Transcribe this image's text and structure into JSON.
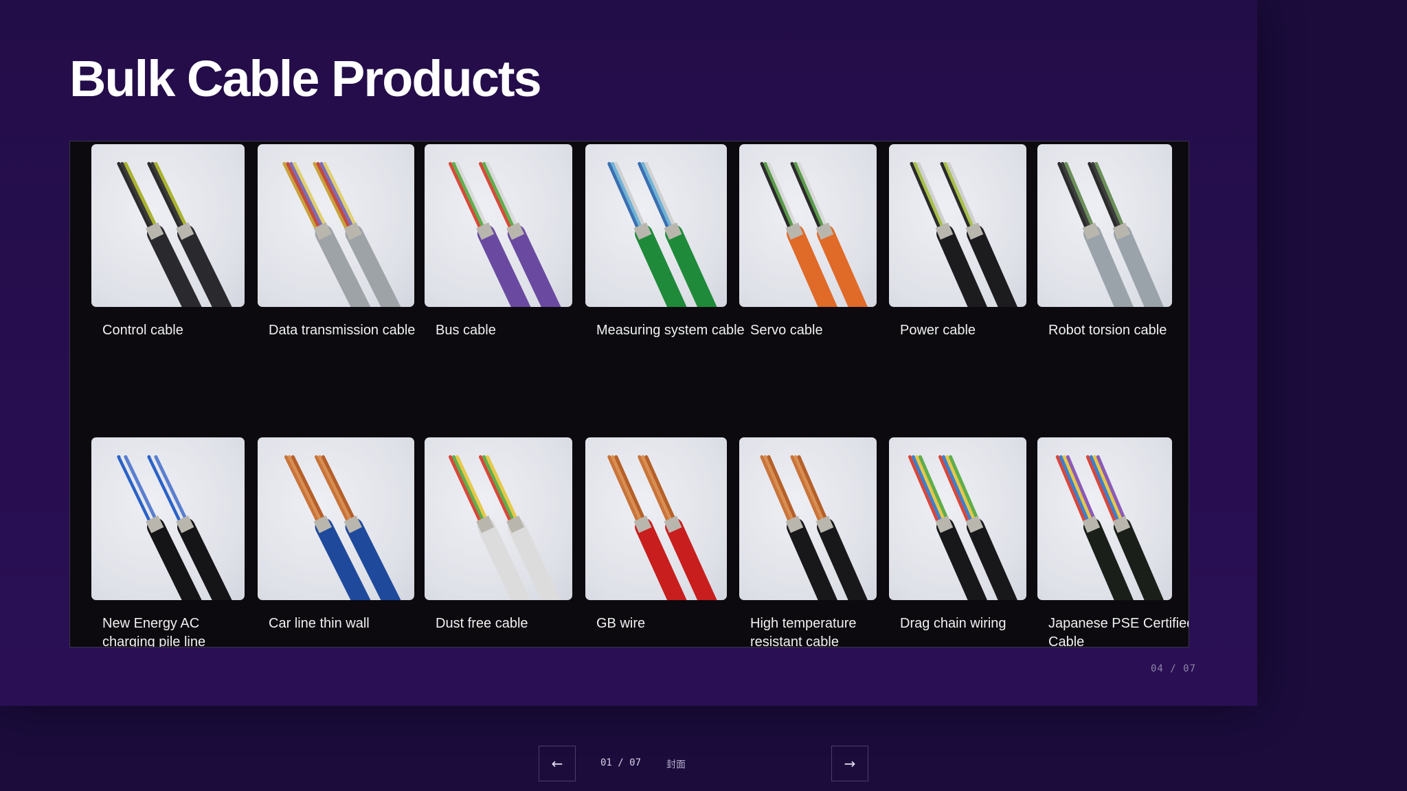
{
  "slide": {
    "title": "Bulk Cable Products",
    "page_indicator": "04 / 07"
  },
  "products": [
    {
      "label": "Control cable",
      "jacket": "#2a2a2e",
      "cores": [
        "#2b2b2b",
        "#3a3a3a",
        "#a9b22f"
      ]
    },
    {
      "label": "Data transmission cable",
      "jacket": "#9ea3a8",
      "cores": [
        "#c8a23a",
        "#c44a3e",
        "#7b6cb8",
        "#e0d070"
      ]
    },
    {
      "label": "Bus cable",
      "jacket": "#6a4aa0",
      "cores": [
        "#d74a3a",
        "#5fae4e",
        "#d9d9d9"
      ]
    },
    {
      "label": "Measuring system cable",
      "jacket": "#1f8a3a",
      "cores": [
        "#3a6fb0",
        "#6fb2d6",
        "#d0d0d0"
      ]
    },
    {
      "label": "Servo cable",
      "jacket": "#e06a28",
      "cores": [
        "#2b2b2b",
        "#5a9a4a",
        "#d8d8d8"
      ]
    },
    {
      "label": "Power cable",
      "jacket": "#1c1c1f",
      "cores": [
        "#2b2b2b",
        "#a7c04a",
        "#cfcfcf"
      ]
    },
    {
      "label": "Robot torsion cable",
      "jacket": "#9aa3aa",
      "cores": [
        "#2b2b2b",
        "#3d3d3d",
        "#6b8f5a"
      ]
    },
    {
      "label": "New Energy AC charging pile line",
      "jacket": "#151517",
      "cores": [
        "#2a62c8",
        "#e8e8e8",
        "#5a7fd0"
      ]
    },
    {
      "label": "Car line thin wall",
      "jacket": "#1f4a9c",
      "cores": [
        "#c8743a",
        "#d98e52",
        "#b5602a"
      ]
    },
    {
      "label": "Dust free cable",
      "jacket": "#dcdcdc",
      "cores": [
        "#d8473a",
        "#5fae4e",
        "#e6c84a"
      ]
    },
    {
      "label": "GB wire",
      "jacket": "#c81e1e",
      "cores": [
        "#c8743a",
        "#d98e52",
        "#b5602a"
      ]
    },
    {
      "label": "High temperature resistant cable",
      "jacket": "#18181a",
      "cores": [
        "#c8743a",
        "#d98e52",
        "#b5602a"
      ]
    },
    {
      "label": "Drag chain wiring",
      "jacket": "#18181a",
      "cores": [
        "#d8473a",
        "#3a7fd0",
        "#e6c84a",
        "#5fae4e"
      ]
    },
    {
      "label": "Japanese PSE Certified Cable",
      "jacket": "#1a1f1a",
      "cores": [
        "#d8473a",
        "#3a7fd0",
        "#e6c84a",
        "#8a5ab8"
      ]
    }
  ],
  "nav": {
    "prev_label": "←",
    "next_label": "→",
    "counter": "01 / 07",
    "section": "封面"
  }
}
